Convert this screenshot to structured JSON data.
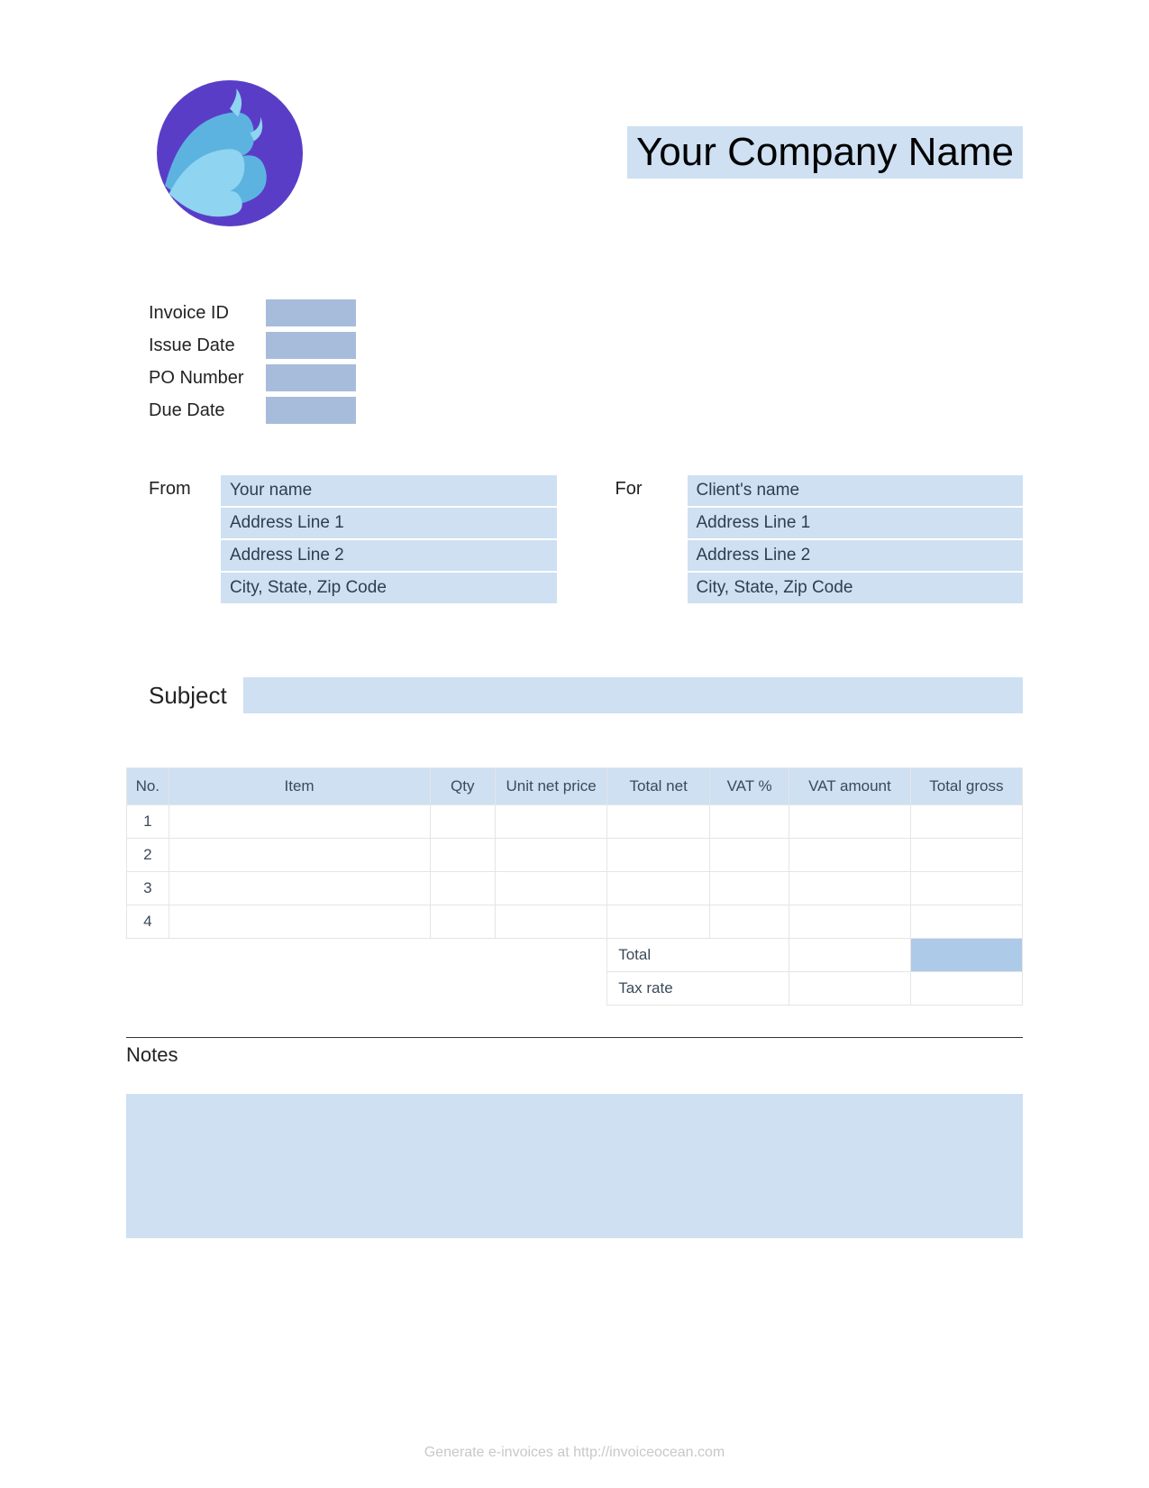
{
  "company_name": "Your Company Name",
  "meta": {
    "invoice_id_label": "Invoice ID",
    "invoice_id": "",
    "issue_date_label": "Issue Date",
    "issue_date": "",
    "po_number_label": "PO Number",
    "po_number": "",
    "due_date_label": "Due Date",
    "due_date": ""
  },
  "from": {
    "label": "From",
    "name": "Your name",
    "address1": "Address Line 1",
    "address2": "Address Line 2",
    "city": "City, State, Zip Code"
  },
  "for": {
    "label": "For",
    "name": "Client's name",
    "address1": "Address Line 1",
    "address2": "Address Line 2",
    "city": "City, State, Zip Code"
  },
  "subject": {
    "label": "Subject",
    "value": ""
  },
  "table": {
    "headers": {
      "no": "No.",
      "item": "Item",
      "qty": "Qty",
      "unit_net_price": "Unit net price",
      "total_net": "Total net",
      "vat_pct": "VAT %",
      "vat_amount": "VAT amount",
      "total_gross": "Total gross"
    },
    "rows": [
      {
        "no": "1",
        "item": "",
        "qty": "",
        "unit_net_price": "",
        "total_net": "",
        "vat_pct": "",
        "vat_amount": "",
        "total_gross": ""
      },
      {
        "no": "2",
        "item": "",
        "qty": "",
        "unit_net_price": "",
        "total_net": "",
        "vat_pct": "",
        "vat_amount": "",
        "total_gross": ""
      },
      {
        "no": "3",
        "item": "",
        "qty": "",
        "unit_net_price": "",
        "total_net": "",
        "vat_pct": "",
        "vat_amount": "",
        "total_gross": ""
      },
      {
        "no": "4",
        "item": "",
        "qty": "",
        "unit_net_price": "",
        "total_net": "",
        "vat_pct": "",
        "vat_amount": "",
        "total_gross": ""
      }
    ],
    "summary": {
      "total_label": "Total",
      "total_vat_amount": "",
      "total_gross": "",
      "tax_rate_label": "Tax rate",
      "tax_rate_vat_amount": "",
      "tax_rate_gross": ""
    }
  },
  "notes": {
    "label": "Notes",
    "value": ""
  },
  "footer": {
    "text": "Generate e-invoices at http://invoiceocean.com"
  }
}
